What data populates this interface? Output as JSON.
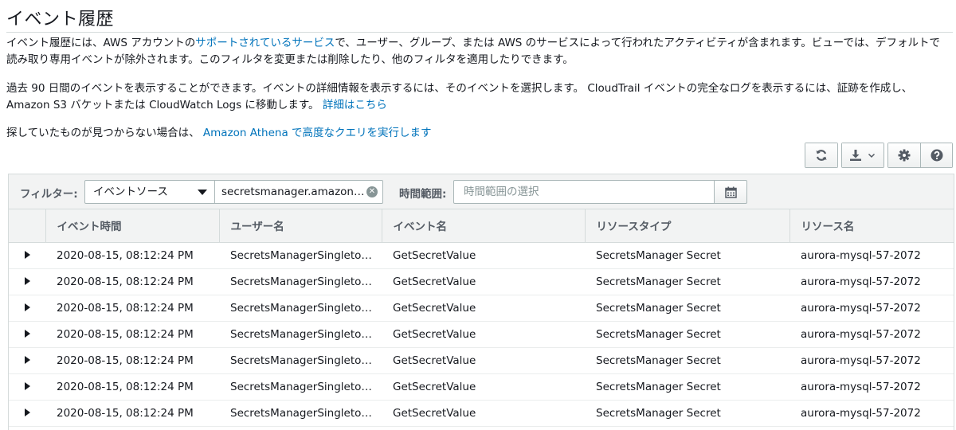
{
  "page": {
    "title": "イベント履歴"
  },
  "intro": {
    "p1_a": "イベント履歴には、AWS アカウントの",
    "p1_link": "サポートされているサービス",
    "p1_b": "で、ユーザー、グループ、または AWS のサービスによって行われたアクティビティが含まれます。ビューでは、デフォルトで読み取り専用イベントが除外されます。このフィルタを変更または削除したり、他のフィルタを適用したりできます。",
    "p2_a": "過去 90 日間のイベントを表示することができます。イベントの詳細情報を表示するには、そのイベントを選択します。 CloudTrail イベントの完全なログを表示するには、証跡を作成し、Amazon S3 バケットまたは CloudWatch Logs に移動します。",
    "p2_link": "詳細はこちら",
    "p3_a": "探していたものが見つからない場合は、",
    "p3_link": "Amazon Athena で高度なクエリを実行します"
  },
  "toolbar": {
    "icons": [
      "refresh-icon",
      "download-icon",
      "chevron-down-icon",
      "gear-icon",
      "help-icon"
    ]
  },
  "filter": {
    "label": "フィルター:",
    "attribute": "イベントソース",
    "value": "secretsmanager.amazon…",
    "time_label": "時間範囲:",
    "time_placeholder": "時間範囲の選択"
  },
  "table": {
    "columns": [
      "イベント時間",
      "ユーザー名",
      "イベント名",
      "リソースタイプ",
      "リソース名"
    ],
    "rows": [
      [
        "2020-08-15, 08:12:24 PM",
        "SecretsManagerSingleto…",
        "GetSecretValue",
        "SecretsManager Secret",
        "aurora-mysql-57-2072"
      ],
      [
        "2020-08-15, 08:12:24 PM",
        "SecretsManagerSingleto…",
        "GetSecretValue",
        "SecretsManager Secret",
        "aurora-mysql-57-2072"
      ],
      [
        "2020-08-15, 08:12:24 PM",
        "SecretsManagerSingleto…",
        "GetSecretValue",
        "SecretsManager Secret",
        "aurora-mysql-57-2072"
      ],
      [
        "2020-08-15, 08:12:24 PM",
        "SecretsManagerSingleto…",
        "GetSecretValue",
        "SecretsManager Secret",
        "aurora-mysql-57-2072"
      ],
      [
        "2020-08-15, 08:12:24 PM",
        "SecretsManagerSingleto…",
        "GetSecretValue",
        "SecretsManager Secret",
        "aurora-mysql-57-2072"
      ],
      [
        "2020-08-15, 08:12:24 PM",
        "SecretsManagerSingleto…",
        "GetSecretValue",
        "SecretsManager Secret",
        "aurora-mysql-57-2072"
      ],
      [
        "2020-08-15, 08:12:24 PM",
        "SecretsManagerSingleto…",
        "GetSecretValue",
        "SecretsManager Secret",
        "aurora-mysql-57-2072"
      ]
    ]
  },
  "colors": {
    "link": "#0073bb",
    "header_bg": "#f2f3f3",
    "border": "#d5dbdb"
  }
}
